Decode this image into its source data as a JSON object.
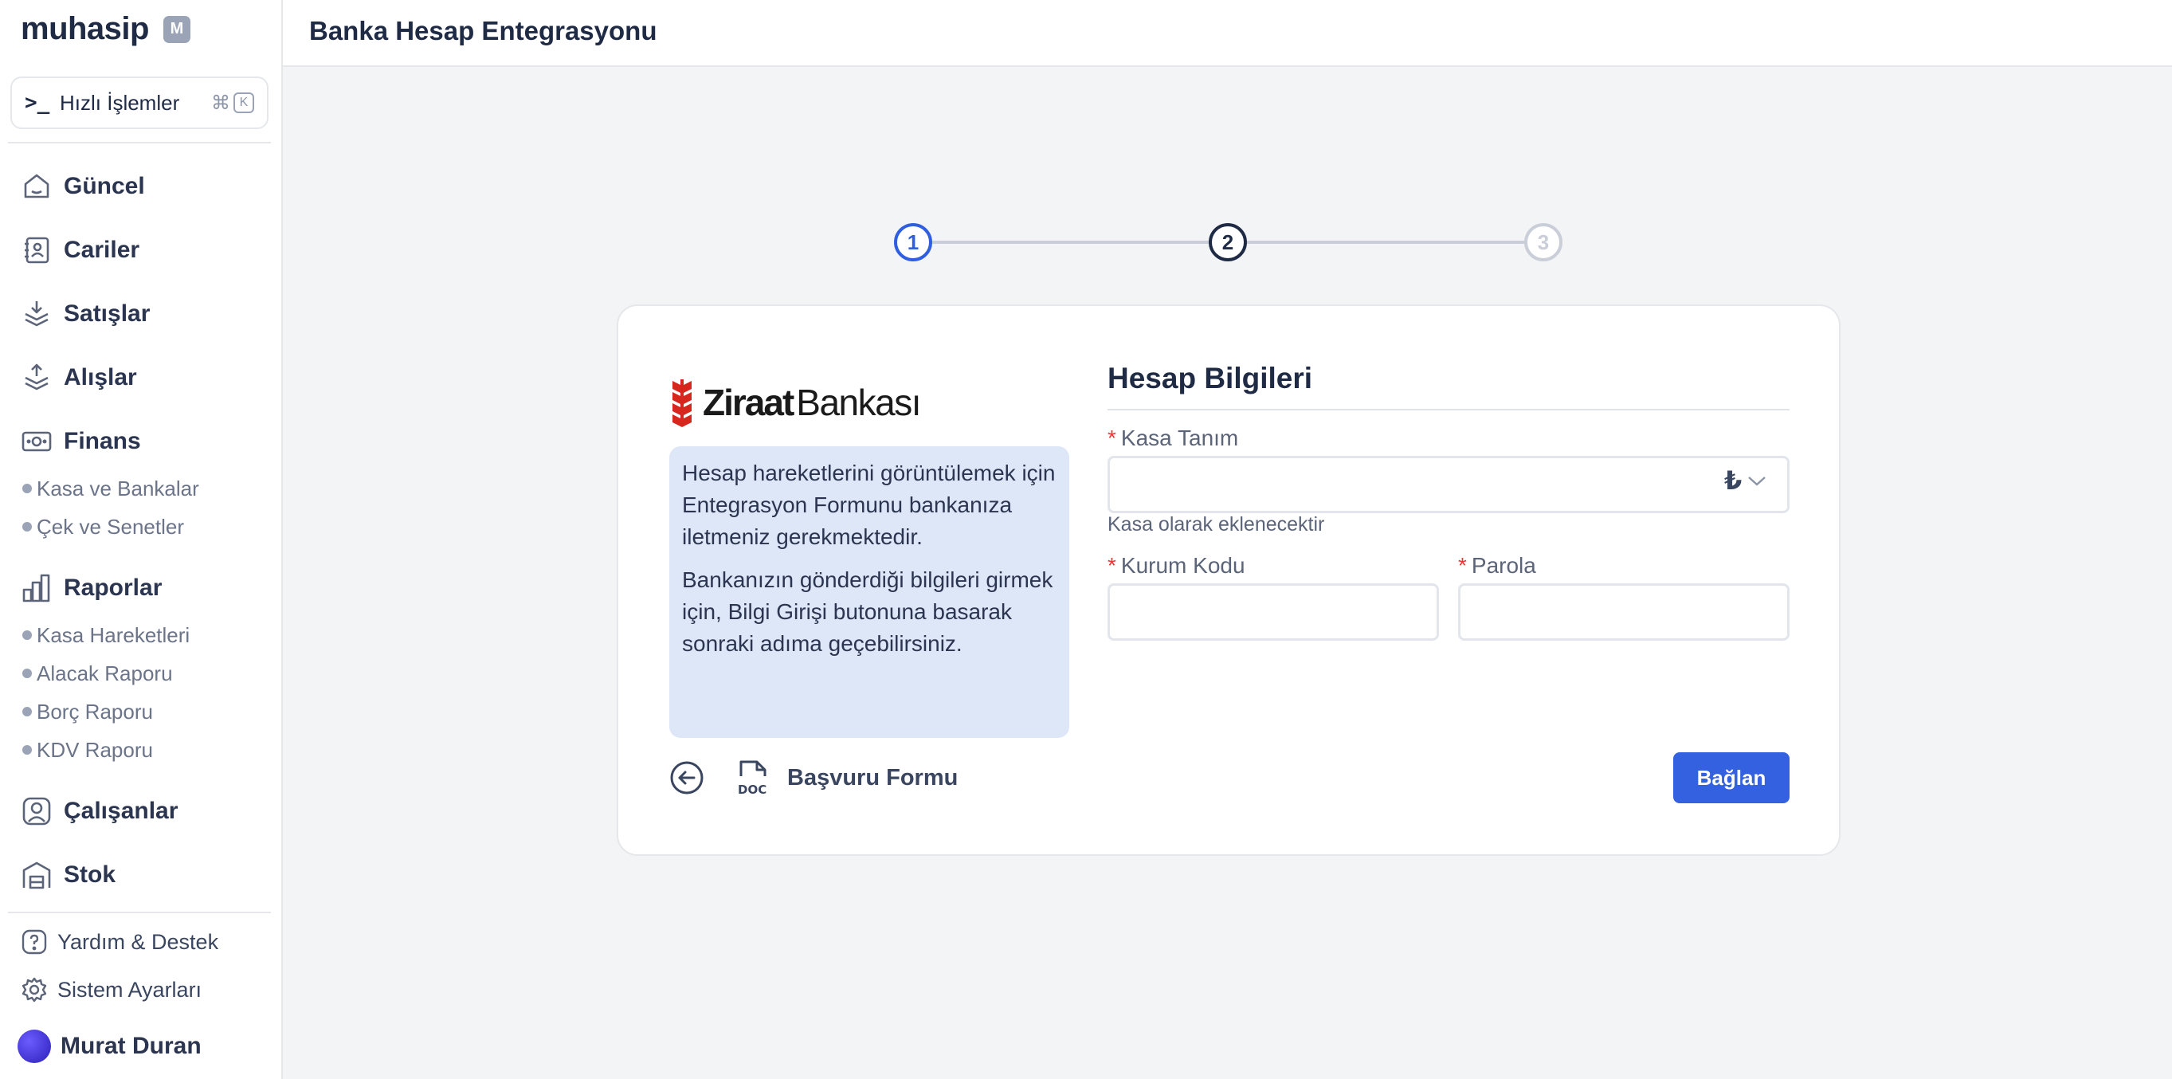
{
  "app": {
    "logo": "muhasip",
    "badge": "M"
  },
  "quick_actions": {
    "label": "Hızlı İşlemler",
    "shortcut_symbol": "⌘",
    "shortcut_key": "K"
  },
  "nav": {
    "current": "Güncel",
    "accounts": "Cariler",
    "sales": "Satışlar",
    "purchases": "Alışlar",
    "finance": "Finans",
    "finance_items": [
      "Kasa ve Bankalar",
      "Çek ve Senetler"
    ],
    "reports": "Raporlar",
    "report_items": [
      "Kasa Hareketleri",
      "Alacak Raporu",
      "Borç Raporu",
      "KDV Raporu"
    ],
    "employees": "Çalışanlar",
    "stock": "Stok"
  },
  "bottom": {
    "help": "Yardım & Destek",
    "settings": "Sistem Ayarları",
    "user": "Murat Duran"
  },
  "header": {
    "title": "Banka Hesap Entegrasyonu"
  },
  "stepper": {
    "steps": [
      "1",
      "2",
      "3"
    ]
  },
  "bank": {
    "name_bold": "Ziraat",
    "name_light": "Bankası",
    "info_1": "Hesap hareketlerini görüntülemek için Entegrasyon Formunu bankanıza iletmeniz gerekmektedir.",
    "info_2": "Bankanızın gönderdiği bilgileri girmek için, Bilgi Girişi butonuna basarak sonraki adıma geçebilirsiniz.",
    "form_link": "Başvuru Formu"
  },
  "form": {
    "title": "Hesap Bilgileri",
    "required_mark": "*",
    "kasa_label": "Kasa Tanım",
    "kasa_value": "",
    "currency_symbol": "₺",
    "kasa_helper": "Kasa olarak eklenecektir",
    "kurum_label": "Kurum Kodu",
    "kurum_value": "",
    "parola_label": "Parola",
    "parola_value": "",
    "submit_label": "Bağlan"
  },
  "colors": {
    "primary": "#3361e0",
    "active_step": "#2f5fe0",
    "info_bg": "#dde7f8",
    "bank_red": "#d7261e"
  }
}
